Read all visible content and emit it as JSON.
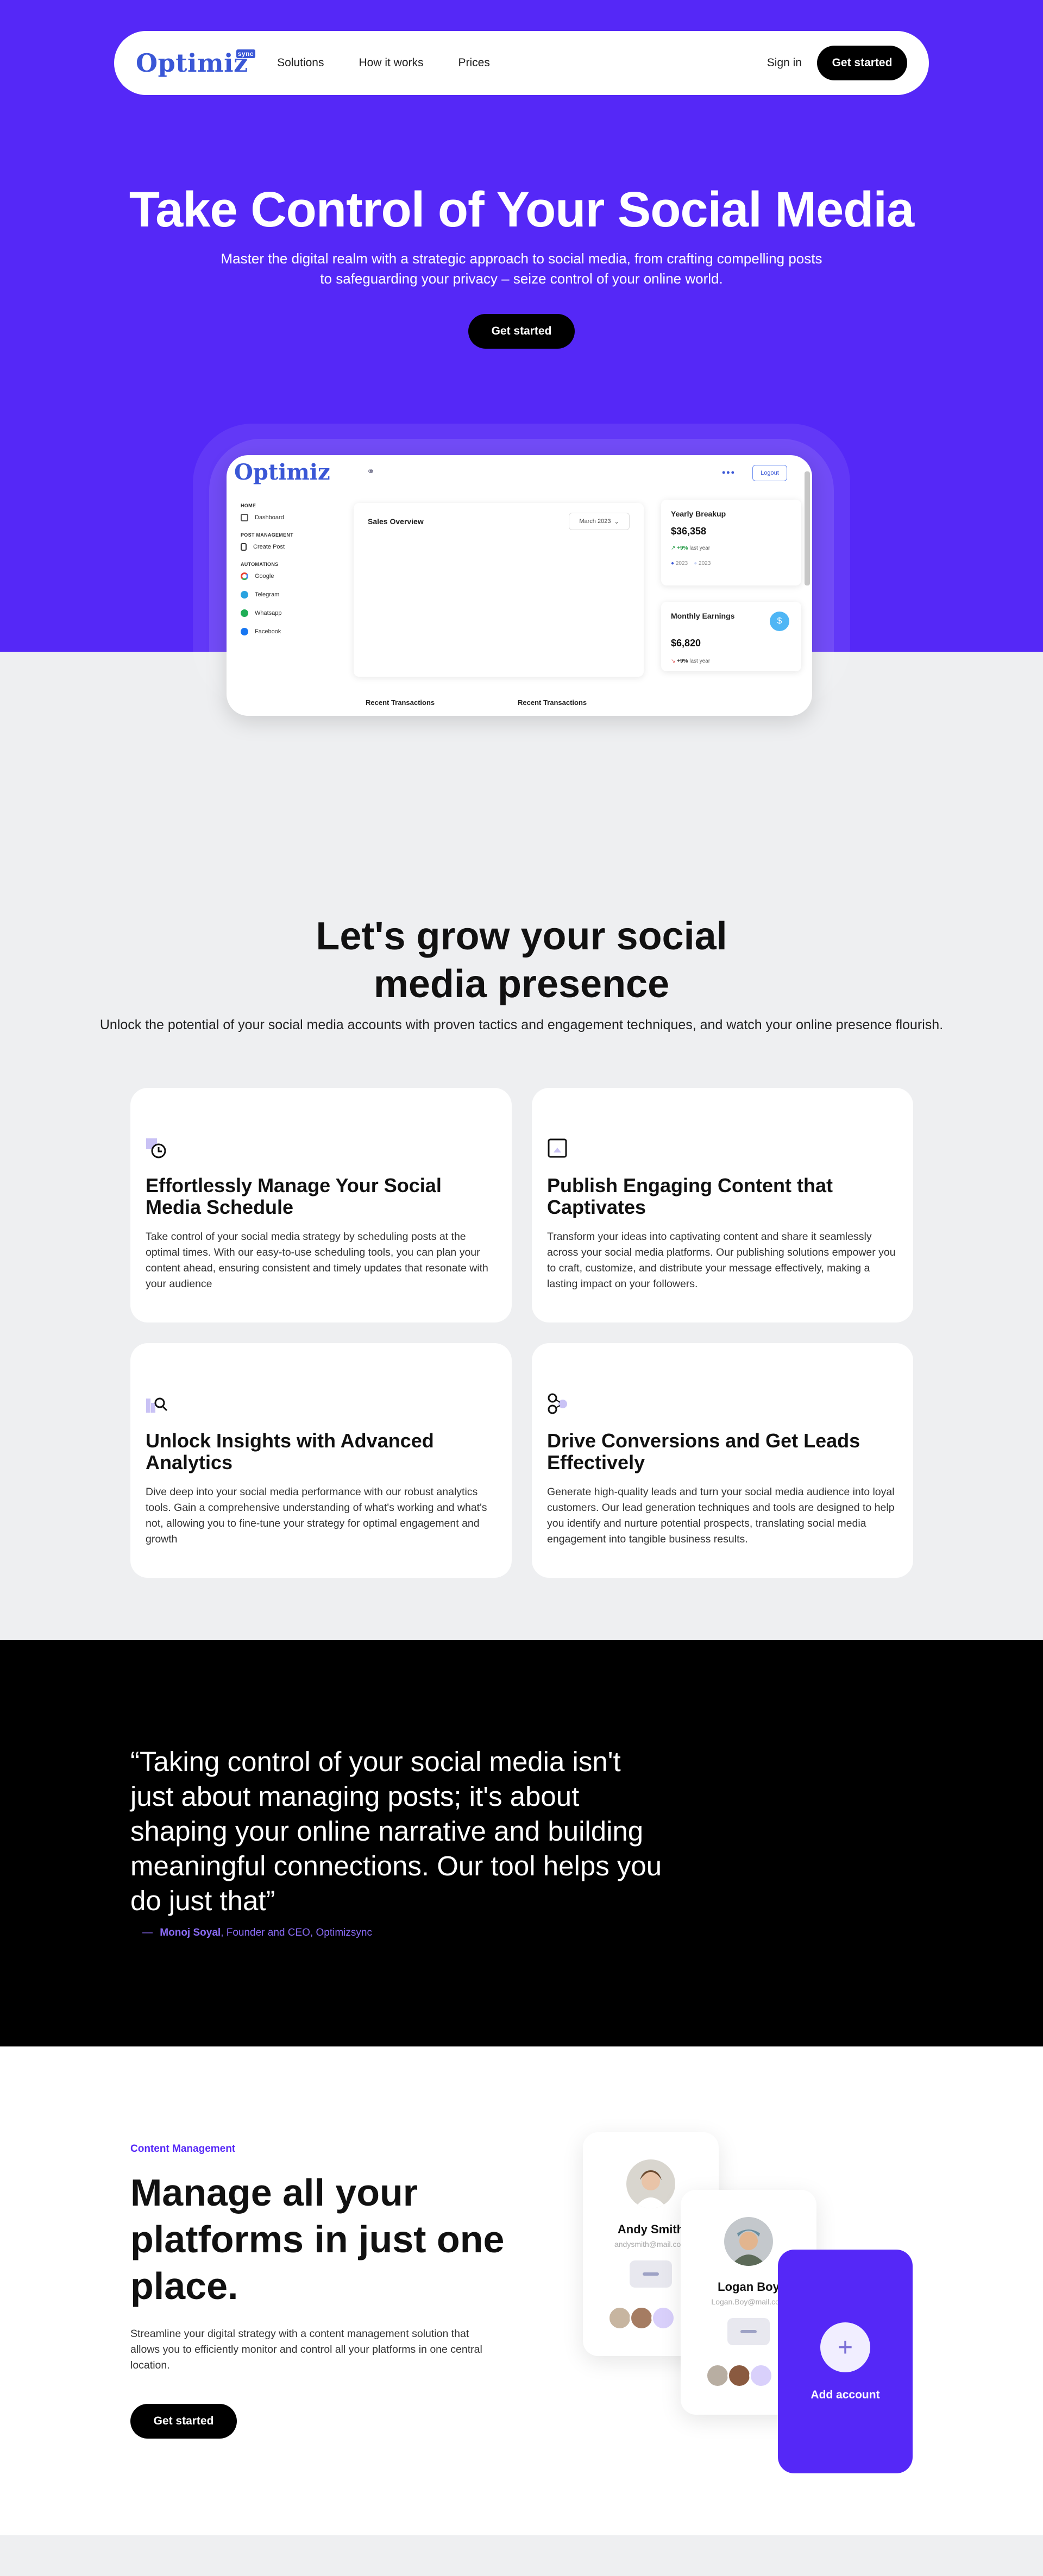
{
  "nav": {
    "logo": "Optimiz",
    "logo_badge": "sync",
    "links": [
      "Solutions",
      "How it works",
      "Prices"
    ],
    "signin": "Sign in",
    "cta": "Get started"
  },
  "hero": {
    "title": "Take Control of Your Social Media",
    "subtitle": "Master the digital realm with a strategic approach to social media, from crafting compelling posts to safeguarding your privacy – seize control of your online world.",
    "cta": "Get started"
  },
  "dashboard": {
    "logo": "Optimiz",
    "logout": "Logout",
    "sections": {
      "home": "HOME",
      "post": "POST MANAGEMENT",
      "auto": "AUTOMATIONS"
    },
    "items": {
      "dashboard": "Dashboard",
      "create_post": "Create Post",
      "google": "Google",
      "telegram": "Telegram",
      "whatsapp": "Whatsapp",
      "facebook": "Facebook"
    },
    "sales_title": "Sales Overview",
    "sales_period": "March 2023",
    "yearly": {
      "title": "Yearly Breakup",
      "value": "$36,358",
      "change": "+9%",
      "change_text": "last year",
      "legend1": "2023",
      "legend2": "2023"
    },
    "monthly": {
      "title": "Monthly Earnings",
      "value": "$6,820",
      "change": "+9%",
      "change_text": "last year",
      "badge": "$"
    },
    "recent1": "Recent Transactions",
    "recent2": "Recent Transactions"
  },
  "grow": {
    "title": "Let's grow your social media presence",
    "subtitle": "Unlock the potential of your social media accounts with proven tactics and engagement techniques, and watch your online presence flourish."
  },
  "features": [
    {
      "title": "Effortlessly Manage Your Social Media Schedule",
      "text": "Take control of your social media strategy by scheduling posts at the optimal times. With our easy-to-use scheduling tools, you can plan your content ahead, ensuring consistent and timely updates that resonate with your audience",
      "icon": "clock-icon"
    },
    {
      "title": "Publish Engaging Content that Captivates",
      "text": "Transform your ideas into captivating content and share it seamlessly across your social media platforms. Our publishing solutions empower you to craft, customize, and distribute your message effectively, making a lasting impact on your followers.",
      "icon": "image-icon"
    },
    {
      "title": "Unlock Insights with Advanced Analytics",
      "text": "Dive deep into your social media performance with our robust analytics tools. Gain a comprehensive understanding of what's working and what's not, allowing you to fine-tune your strategy for optimal engagement and growth",
      "icon": "analytics-icon"
    },
    {
      "title": "Drive Conversions and Get Leads Effectively",
      "text": "Generate high-quality leads and turn your social media audience into loyal customers. Our lead generation techniques and tools are designed to help you identify and nurture potential prospects, translating social media engagement into tangible business results.",
      "icon": "leads-icon"
    }
  ],
  "quote": {
    "text": "“Taking control of your social media isn't just about managing posts; it's about shaping your online narrative and building meaningful connections. Our tool helps you do just that”",
    "dash": "—",
    "author": "Monoj Soyal",
    "role": ", Founder and CEO, Optimizsync"
  },
  "content_mgmt": {
    "tag": "Content Management",
    "title": "Manage all your platforms in just one place.",
    "text": "Streamline your digital strategy with a content management solution that allows you to efficiently monitor and control all your platforms in one central location.",
    "cta": "Get started",
    "profiles": [
      {
        "name": "Andy Smith",
        "email": "andysmith@mail.com"
      },
      {
        "name": "Logan Boy",
        "email": "Logan.Boy@mail.com"
      }
    ],
    "add_label": "Add account",
    "add_symbol": "+"
  },
  "colors": {
    "brand": "#5528f7",
    "logo": "#3a57d6",
    "dark": "#000000",
    "page_bg": "#eeeff1"
  }
}
